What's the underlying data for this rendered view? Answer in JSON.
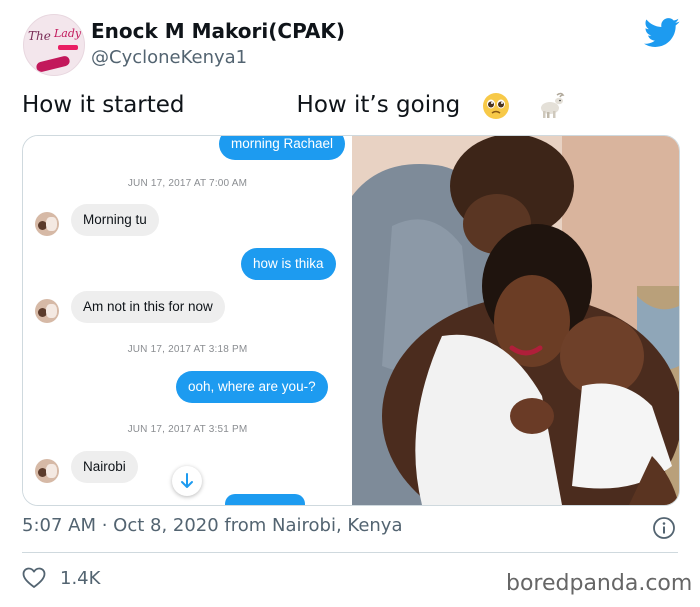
{
  "author": {
    "name": "Enock M Makori(CPAK)",
    "handle": "@CycloneKenya1",
    "avatar_text": [
      "The",
      "Lady"
    ]
  },
  "tweet": {
    "text_left": "How it started",
    "text_right": "How it’s going",
    "emojis": [
      "face-with-pleading-eyes-emoji",
      "goat-emoji"
    ]
  },
  "chat": {
    "messages": [
      {
        "type": "out",
        "text": "morning Rachael"
      },
      {
        "type": "timestamp",
        "text": "JUN 17, 2017 AT 7:00 AM"
      },
      {
        "type": "in",
        "text": "Morning  tu"
      },
      {
        "type": "out",
        "text": "how is thika"
      },
      {
        "type": "in",
        "text": "Am not in this for  now"
      },
      {
        "type": "timestamp",
        "text": "JUN 17, 2017 AT 3:18 PM"
      },
      {
        "type": "out",
        "text": "ooh, where are you-?"
      },
      {
        "type": "timestamp",
        "text": "JUN 17, 2017 AT 3:51 PM"
      },
      {
        "type": "in",
        "text": "Nairobi"
      }
    ]
  },
  "meta": {
    "time_line": "5:07 AM · Oct 8, 2020 from Nairobi, Kenya"
  },
  "actions": {
    "like_count": "1.4K"
  },
  "watermark": "boredpanda.com",
  "colors": {
    "twitter_blue": "#1d9bf0",
    "text_primary": "#0f1419",
    "text_secondary": "#536471",
    "bubble_incoming": "#eeeeee"
  }
}
